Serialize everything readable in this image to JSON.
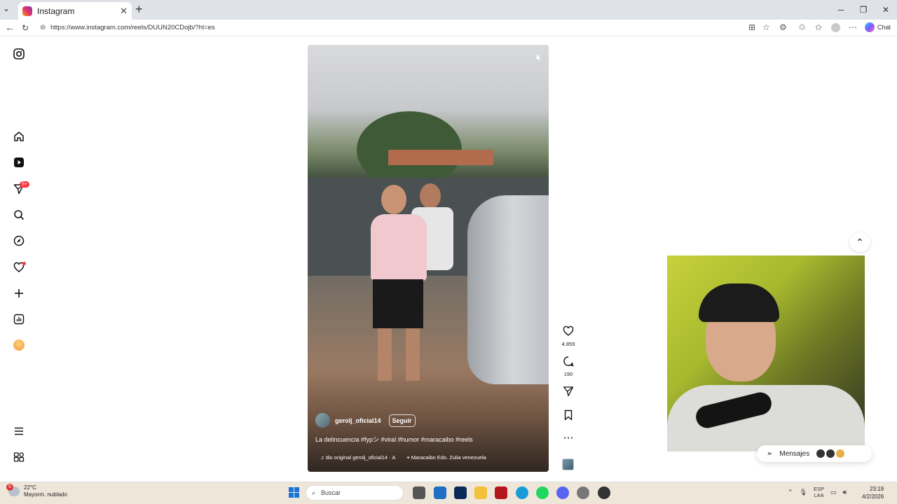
{
  "browser": {
    "tab_title": "Instagram",
    "url": "https://www.instagram.com/reels/DUUN20CDojb/?hl=es",
    "chat_label": "Chat"
  },
  "sidebar": {
    "notifications_badge": "9+"
  },
  "reel": {
    "username": "gerolj_oficial14",
    "follow_label": "Seguir",
    "caption": "La delincuencia #fypシ #viral #humor #maracaibo #reels",
    "audio": "dio original  gerolj_oficial14 · A",
    "location": "Maracaibo Edo. Zulia venezuela",
    "likes": "4.859",
    "comments": "190"
  },
  "messages": {
    "label": "Mensajes"
  },
  "taskbar": {
    "weather_temp": "22°C",
    "weather_desc": "Mayorm. nublado",
    "weather_badge": "5",
    "search_label": "Buscar",
    "lang_top": "ESP",
    "lang_bottom": "LAA",
    "time": "23:19",
    "date": "4/2/2026"
  }
}
